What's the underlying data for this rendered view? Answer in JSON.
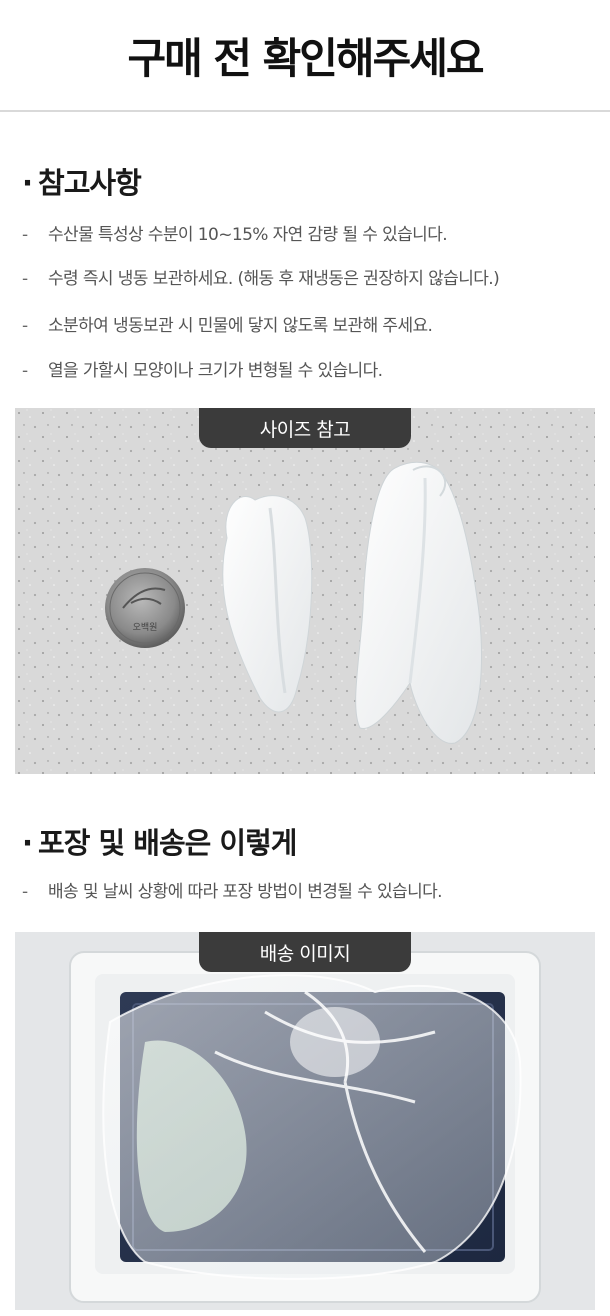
{
  "page_title": "구매 전 확인해주세요",
  "sections": [
    {
      "dot": "·",
      "title": "참고사항",
      "notes": [
        "수산물 특성상 수분이 10~15% 자연 감량 될 수 있습니다.",
        "수령 즉시 냉동 보관하세요. (해동 후 재냉동은 권장하지 않습니다.)",
        "소분하여 냉동보관 시 민물에 닿지 않도록 보관해 주세요.",
        "열을 가할시 모양이나 크기가 변형될 수 있습니다."
      ],
      "image_badge": "사이즈 참고"
    },
    {
      "dot": "·",
      "title": "포장 및 배송은 이렇게",
      "notes": [
        "배송 및 날씨 상황에 따라 포장 방법이 변경될 수 있습니다."
      ],
      "image_badge": "배송 이미지"
    }
  ],
  "note_dash": "-",
  "coin_text": "오백원"
}
